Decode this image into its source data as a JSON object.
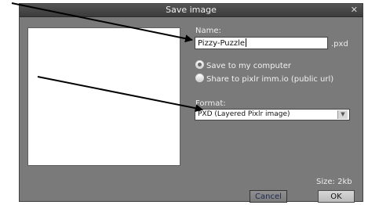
{
  "dialog": {
    "title": "Save image",
    "close_glyph": "✕",
    "name_label": "Name:",
    "name_value": "Pizzy-Puzzle",
    "extension": ".pxd",
    "save_options": [
      {
        "label": "Save to my computer",
        "selected": true
      },
      {
        "label": "Share to pixlr imm.io (public url)",
        "selected": false
      }
    ],
    "format_label": "Format:",
    "format_value": "PXD (Layered Pixlr image)",
    "size_text": "Size: 2kb",
    "cancel_label": "Cancel",
    "ok_label": "OK"
  },
  "icons": {
    "close": "close-icon",
    "dropdown": "chevron-down-icon"
  }
}
